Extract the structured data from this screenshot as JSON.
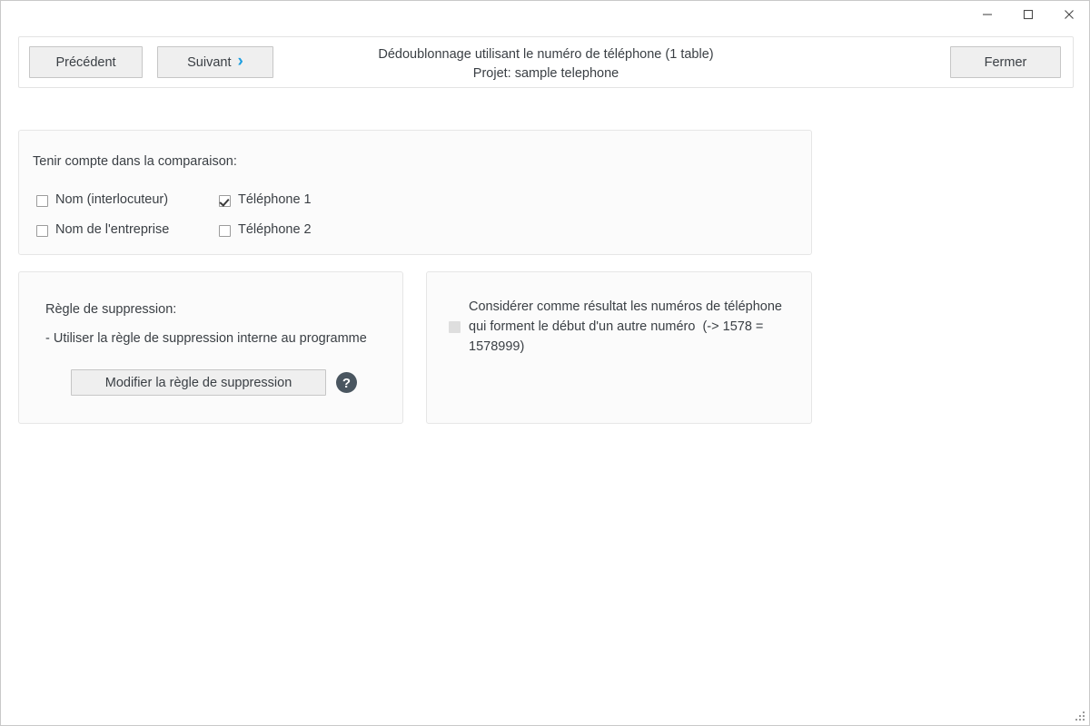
{
  "window": {
    "controls": [
      {
        "name": "minimize-button",
        "glyph": "minimize"
      },
      {
        "name": "maximize-button",
        "glyph": "maximize"
      },
      {
        "name": "close-button",
        "glyph": "close"
      }
    ]
  },
  "toolbar": {
    "previous_label": "Précédent",
    "next_label": "Suivant",
    "next_chevron": "›",
    "close_label": "Fermer",
    "title_line1": "Dédoublonnage utilisant le numéro de téléphone (1 table)",
    "title_line2": "Projet: sample telephone"
  },
  "compare_section": {
    "heading": "Tenir compte dans la comparaison:",
    "options": [
      {
        "label": "Nom (interlocuteur)",
        "checked": false,
        "disabled": false
      },
      {
        "label": "Nom de l'entreprise",
        "checked": false,
        "disabled": false
      },
      {
        "label": "Téléphone 1",
        "checked": true,
        "disabled": false
      },
      {
        "label": "Téléphone 2",
        "checked": false,
        "disabled": false
      }
    ]
  },
  "rule_section": {
    "heading": "Règle de suppression:",
    "current_rule": "- Utiliser la règle de suppression interne au programme",
    "edit_button_label": "Modifier la règle de suppression",
    "help_icon": "question-mark-circle-icon",
    "help_glyph": "?"
  },
  "prefix_section": {
    "checkbox_label": "Considérer comme résultat les numéros de téléphone qui forment le début d'un autre numéro  (-> 1578 = 1578999)",
    "checked": false,
    "disabled": true
  },
  "colors": {
    "accent": "#1e9fe0",
    "text": "#3a3f44",
    "panel_bg": "#fbfbfb",
    "panel_border": "#e6e6e6",
    "button_bg": "#efefef",
    "button_border": "#c6c6c6",
    "help_icon_bg": "#4a5660"
  }
}
